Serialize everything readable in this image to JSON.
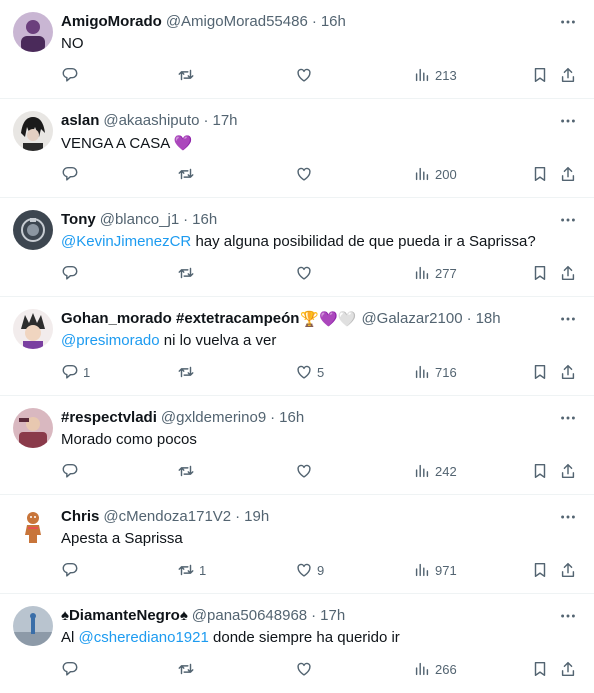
{
  "tweets": [
    {
      "name": "AmigoMorado",
      "handle": "@AmigoMorad55486",
      "sep": "·",
      "time": "16h",
      "text_parts": {
        "mention": "",
        "body": "NO"
      },
      "replies": "",
      "retweets": "",
      "likes": "",
      "views": "213",
      "avatar_color": "#6b3f7d"
    },
    {
      "name": "aslan",
      "handle": "@akaashiputo",
      "sep": "·",
      "time": "17h",
      "text_parts": {
        "mention": "",
        "body": "VENGA A CASA ",
        "emoji": "💜"
      },
      "replies": "",
      "retweets": "",
      "likes": "",
      "views": "200",
      "avatar_color": "#2a2a2a"
    },
    {
      "name": "Tony",
      "handle": "@blanco_j1",
      "sep": "·",
      "time": "16h",
      "text_parts": {
        "mention": "@KevinJimenezCR",
        "body": " hay alguna posibilidad de que pueda ir a Saprissa?"
      },
      "replies": "",
      "retweets": "",
      "likes": "",
      "views": "277",
      "avatar_color": "#5a6470"
    },
    {
      "name": "Gohan_morado #extetracampeón",
      "name_emoji": "🏆💜🤍",
      "handle": "@Galazar2100",
      "sep": "·",
      "time": "18h",
      "text_parts": {
        "mention": "@presimorado",
        "body": " ni lo vuelva a ver"
      },
      "replies": "1",
      "retweets": "",
      "likes": "5",
      "views": "716",
      "avatar_color": "#d9c7c7"
    },
    {
      "name": "#respectvladi",
      "handle": "@gxldemerino9",
      "sep": "·",
      "time": "16h",
      "text_parts": {
        "mention": "",
        "body": "Morado como pocos"
      },
      "replies": "",
      "retweets": "",
      "likes": "",
      "views": "242",
      "avatar_color": "#8a3a4a"
    },
    {
      "name": "Chris",
      "handle": "@cMendoza171V2",
      "sep": "·",
      "time": "19h",
      "text_parts": {
        "mention": "",
        "body": "Apesta a Saprissa"
      },
      "replies": "",
      "retweets": "1",
      "likes": "9",
      "views": "971",
      "avatar_color": "#c8753a"
    },
    {
      "name": "DiamanteNegro",
      "name_prefix": "♠",
      "name_suffix": "♠",
      "handle": "@pana50648968",
      "sep": "·",
      "time": "17h",
      "text_parts": {
        "prefix": "Al ",
        "mention": "@csherediano1921",
        "body": " donde siempre ha querido ir"
      },
      "replies": "",
      "retweets": "",
      "likes": "",
      "views": "266",
      "avatar_color": "#9aa6b4"
    }
  ],
  "icons": {
    "more": "more-horizontal-icon",
    "reply": "reply-icon",
    "retweet": "retweet-icon",
    "like": "heart-icon",
    "views": "views-icon",
    "bookmark": "bookmark-icon",
    "share": "share-icon"
  },
  "colors": {
    "text": "#0f1419",
    "muted": "#536471",
    "link": "#1d9bf0",
    "divider": "#eff3f4"
  }
}
